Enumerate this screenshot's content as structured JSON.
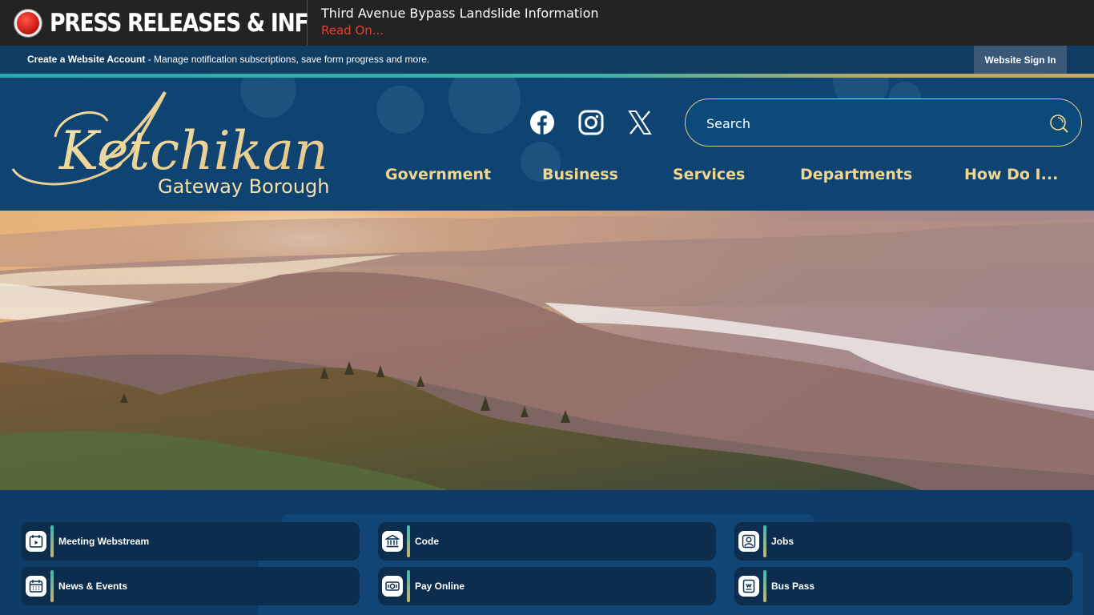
{
  "alert": {
    "label": "PRESS RELEASES & INF",
    "headline": "Third Avenue Bypass Landslide Information",
    "link": "Read On..."
  },
  "account_bar": {
    "create_account": "Create a Website Account",
    "description": " - Manage notification subscriptions, save form progress and more.",
    "sign_in": "Website Sign In"
  },
  "logo": {
    "script_text": "Ketchikan",
    "subtitle": "Gateway Borough"
  },
  "social": [
    {
      "icon": "facebook-icon"
    },
    {
      "icon": "instagram-icon"
    },
    {
      "icon": "x-twitter-icon"
    }
  ],
  "search": {
    "placeholder": "Search"
  },
  "nav": {
    "items": [
      "Government",
      "Business",
      "Services",
      "Departments",
      "How Do I..."
    ]
  },
  "quick_links": [
    {
      "label": "Meeting Webstream",
      "icon": "video-calendar-icon"
    },
    {
      "label": "Code",
      "icon": "courthouse-icon"
    },
    {
      "label": "Jobs",
      "icon": "person-badge-icon"
    },
    {
      "label": "News & Events",
      "icon": "calendar-icon"
    },
    {
      "label": "Pay Online",
      "icon": "money-icon"
    },
    {
      "label": "Bus Pass",
      "icon": "ticket-icon"
    }
  ],
  "colors": {
    "accent_gold": "#f2d68c",
    "alert_red": "#e8412e",
    "header_blue": "#0f4472",
    "dark_panel": "#0d2d4e"
  }
}
